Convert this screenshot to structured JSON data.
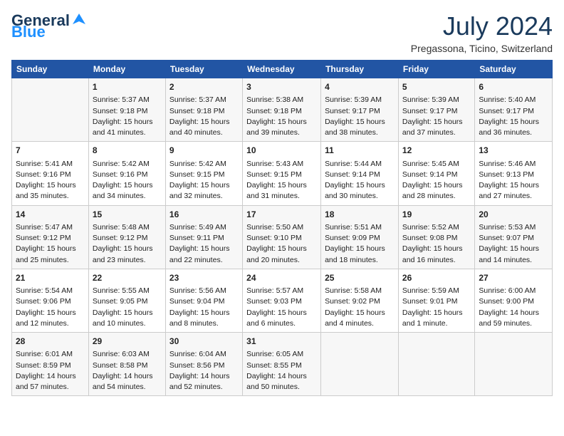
{
  "header": {
    "logo_general": "General",
    "logo_blue": "Blue",
    "month_year": "July 2024",
    "location": "Pregassona, Ticino, Switzerland"
  },
  "days_of_week": [
    "Sunday",
    "Monday",
    "Tuesday",
    "Wednesday",
    "Thursday",
    "Friday",
    "Saturday"
  ],
  "weeks": [
    [
      {
        "day": "",
        "info": ""
      },
      {
        "day": "1",
        "info": "Sunrise: 5:37 AM\nSunset: 9:18 PM\nDaylight: 15 hours\nand 41 minutes."
      },
      {
        "day": "2",
        "info": "Sunrise: 5:37 AM\nSunset: 9:18 PM\nDaylight: 15 hours\nand 40 minutes."
      },
      {
        "day": "3",
        "info": "Sunrise: 5:38 AM\nSunset: 9:18 PM\nDaylight: 15 hours\nand 39 minutes."
      },
      {
        "day": "4",
        "info": "Sunrise: 5:39 AM\nSunset: 9:17 PM\nDaylight: 15 hours\nand 38 minutes."
      },
      {
        "day": "5",
        "info": "Sunrise: 5:39 AM\nSunset: 9:17 PM\nDaylight: 15 hours\nand 37 minutes."
      },
      {
        "day": "6",
        "info": "Sunrise: 5:40 AM\nSunset: 9:17 PM\nDaylight: 15 hours\nand 36 minutes."
      }
    ],
    [
      {
        "day": "7",
        "info": "Sunrise: 5:41 AM\nSunset: 9:16 PM\nDaylight: 15 hours\nand 35 minutes."
      },
      {
        "day": "8",
        "info": "Sunrise: 5:42 AM\nSunset: 9:16 PM\nDaylight: 15 hours\nand 34 minutes."
      },
      {
        "day": "9",
        "info": "Sunrise: 5:42 AM\nSunset: 9:15 PM\nDaylight: 15 hours\nand 32 minutes."
      },
      {
        "day": "10",
        "info": "Sunrise: 5:43 AM\nSunset: 9:15 PM\nDaylight: 15 hours\nand 31 minutes."
      },
      {
        "day": "11",
        "info": "Sunrise: 5:44 AM\nSunset: 9:14 PM\nDaylight: 15 hours\nand 30 minutes."
      },
      {
        "day": "12",
        "info": "Sunrise: 5:45 AM\nSunset: 9:14 PM\nDaylight: 15 hours\nand 28 minutes."
      },
      {
        "day": "13",
        "info": "Sunrise: 5:46 AM\nSunset: 9:13 PM\nDaylight: 15 hours\nand 27 minutes."
      }
    ],
    [
      {
        "day": "14",
        "info": "Sunrise: 5:47 AM\nSunset: 9:12 PM\nDaylight: 15 hours\nand 25 minutes."
      },
      {
        "day": "15",
        "info": "Sunrise: 5:48 AM\nSunset: 9:12 PM\nDaylight: 15 hours\nand 23 minutes."
      },
      {
        "day": "16",
        "info": "Sunrise: 5:49 AM\nSunset: 9:11 PM\nDaylight: 15 hours\nand 22 minutes."
      },
      {
        "day": "17",
        "info": "Sunrise: 5:50 AM\nSunset: 9:10 PM\nDaylight: 15 hours\nand 20 minutes."
      },
      {
        "day": "18",
        "info": "Sunrise: 5:51 AM\nSunset: 9:09 PM\nDaylight: 15 hours\nand 18 minutes."
      },
      {
        "day": "19",
        "info": "Sunrise: 5:52 AM\nSunset: 9:08 PM\nDaylight: 15 hours\nand 16 minutes."
      },
      {
        "day": "20",
        "info": "Sunrise: 5:53 AM\nSunset: 9:07 PM\nDaylight: 15 hours\nand 14 minutes."
      }
    ],
    [
      {
        "day": "21",
        "info": "Sunrise: 5:54 AM\nSunset: 9:06 PM\nDaylight: 15 hours\nand 12 minutes."
      },
      {
        "day": "22",
        "info": "Sunrise: 5:55 AM\nSunset: 9:05 PM\nDaylight: 15 hours\nand 10 minutes."
      },
      {
        "day": "23",
        "info": "Sunrise: 5:56 AM\nSunset: 9:04 PM\nDaylight: 15 hours\nand 8 minutes."
      },
      {
        "day": "24",
        "info": "Sunrise: 5:57 AM\nSunset: 9:03 PM\nDaylight: 15 hours\nand 6 minutes."
      },
      {
        "day": "25",
        "info": "Sunrise: 5:58 AM\nSunset: 9:02 PM\nDaylight: 15 hours\nand 4 minutes."
      },
      {
        "day": "26",
        "info": "Sunrise: 5:59 AM\nSunset: 9:01 PM\nDaylight: 15 hours\nand 1 minute."
      },
      {
        "day": "27",
        "info": "Sunrise: 6:00 AM\nSunset: 9:00 PM\nDaylight: 14 hours\nand 59 minutes."
      }
    ],
    [
      {
        "day": "28",
        "info": "Sunrise: 6:01 AM\nSunset: 8:59 PM\nDaylight: 14 hours\nand 57 minutes."
      },
      {
        "day": "29",
        "info": "Sunrise: 6:03 AM\nSunset: 8:58 PM\nDaylight: 14 hours\nand 54 minutes."
      },
      {
        "day": "30",
        "info": "Sunrise: 6:04 AM\nSunset: 8:56 PM\nDaylight: 14 hours\nand 52 minutes."
      },
      {
        "day": "31",
        "info": "Sunrise: 6:05 AM\nSunset: 8:55 PM\nDaylight: 14 hours\nand 50 minutes."
      },
      {
        "day": "",
        "info": ""
      },
      {
        "day": "",
        "info": ""
      },
      {
        "day": "",
        "info": ""
      }
    ]
  ]
}
